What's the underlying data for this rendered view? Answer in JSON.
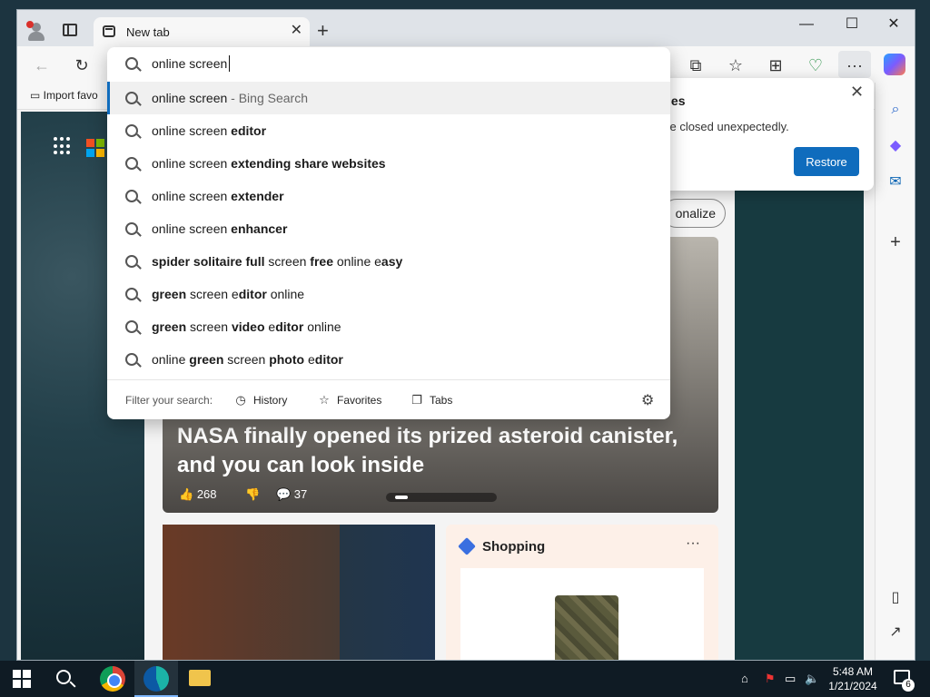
{
  "window": {
    "tab_title": "New tab",
    "tab_close": "✕",
    "new_tab": "+",
    "minimize": "—",
    "maximize": "☐",
    "close": "✕"
  },
  "toolbar": {
    "back_icon": "←",
    "refresh_icon": "↻",
    "split_icon": "⧉",
    "favorites_icon": "☆",
    "collections_icon": "⊞",
    "health_icon": "♡",
    "more_icon": "···"
  },
  "favorites_bar": {
    "import_label": "Import favo"
  },
  "address_bar": {
    "query": "online screen"
  },
  "suggestions": [
    {
      "parts": [
        {
          "t": "online screen",
          "b": false
        },
        {
          "t": " - Bing Search",
          "b": false,
          "muted": true
        }
      ],
      "highlighted": true
    },
    {
      "parts": [
        {
          "t": "online screen ",
          "b": false
        },
        {
          "t": "editor",
          "b": true
        }
      ]
    },
    {
      "parts": [
        {
          "t": "online screen ",
          "b": false
        },
        {
          "t": "extending share websites",
          "b": true
        }
      ]
    },
    {
      "parts": [
        {
          "t": "online screen ",
          "b": false
        },
        {
          "t": "extender",
          "b": true
        }
      ]
    },
    {
      "parts": [
        {
          "t": "online screen ",
          "b": false
        },
        {
          "t": "enhancer",
          "b": true
        }
      ]
    },
    {
      "parts": [
        {
          "t": "spider solitaire full",
          "b": true
        },
        {
          "t": " screen ",
          "b": false
        },
        {
          "t": "free",
          "b": true
        },
        {
          "t": " online e",
          "b": false
        },
        {
          "t": "asy",
          "b": true
        }
      ]
    },
    {
      "parts": [
        {
          "t": "green",
          "b": true
        },
        {
          "t": " screen e",
          "b": false
        },
        {
          "t": "ditor",
          "b": true
        },
        {
          "t": " online",
          "b": false
        }
      ]
    },
    {
      "parts": [
        {
          "t": "green",
          "b": true
        },
        {
          "t": " screen ",
          "b": false
        },
        {
          "t": "video",
          "b": true
        },
        {
          "t": " e",
          "b": false
        },
        {
          "t": "ditor",
          "b": true
        },
        {
          "t": " online",
          "b": false
        }
      ]
    },
    {
      "parts": [
        {
          "t": "online ",
          "b": false
        },
        {
          "t": "green",
          "b": true
        },
        {
          "t": " screen ",
          "b": false
        },
        {
          "t": "photo",
          "b": true
        },
        {
          "t": " e",
          "b": false
        },
        {
          "t": "ditor",
          "b": true
        }
      ]
    }
  ],
  "filter": {
    "label": "Filter your search:",
    "history": "History",
    "favorites": "Favorites",
    "tabs": "Tabs",
    "settings_icon": "⚙"
  },
  "restore_popup": {
    "title": "Restore pages",
    "message": "Microsoft Edge closed unexpectedly.",
    "button": "Restore",
    "close": "✕"
  },
  "feed": {
    "personalize_label": "onalize",
    "headline": "NASA finally opened its prized asteroid canister, and you can look inside",
    "likes": "268",
    "comments": "37",
    "shopping_label": "Shopping",
    "shopping_more": "···"
  },
  "taskbar": {
    "time": "5:48 AM",
    "date": "1/21/2024",
    "notification_count": "6"
  }
}
